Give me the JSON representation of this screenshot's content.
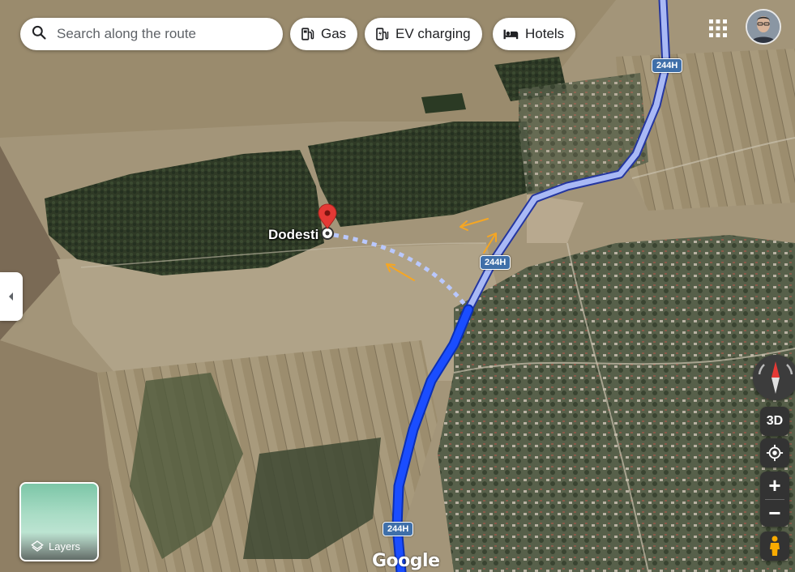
{
  "search": {
    "placeholder": "Search along the route"
  },
  "chips": [
    {
      "label": "Gas",
      "icon": "gas-station-icon"
    },
    {
      "label": "EV charging",
      "icon": "ev-charging-icon"
    },
    {
      "label": "Hotels",
      "icon": "hotel-bed-icon"
    }
  ],
  "map": {
    "place_label": "Dodesti",
    "road_shields": [
      "244H",
      "244H",
      "244H"
    ],
    "attribution": "Google",
    "route_color": "#1a4dff",
    "route_traveled_color": "#a9b9f5",
    "marker_color": "#e53935"
  },
  "layers_button": {
    "label": "Layers"
  },
  "controls": {
    "three_d_label": "3D",
    "zoom_in": "+",
    "zoom_out": "−"
  }
}
